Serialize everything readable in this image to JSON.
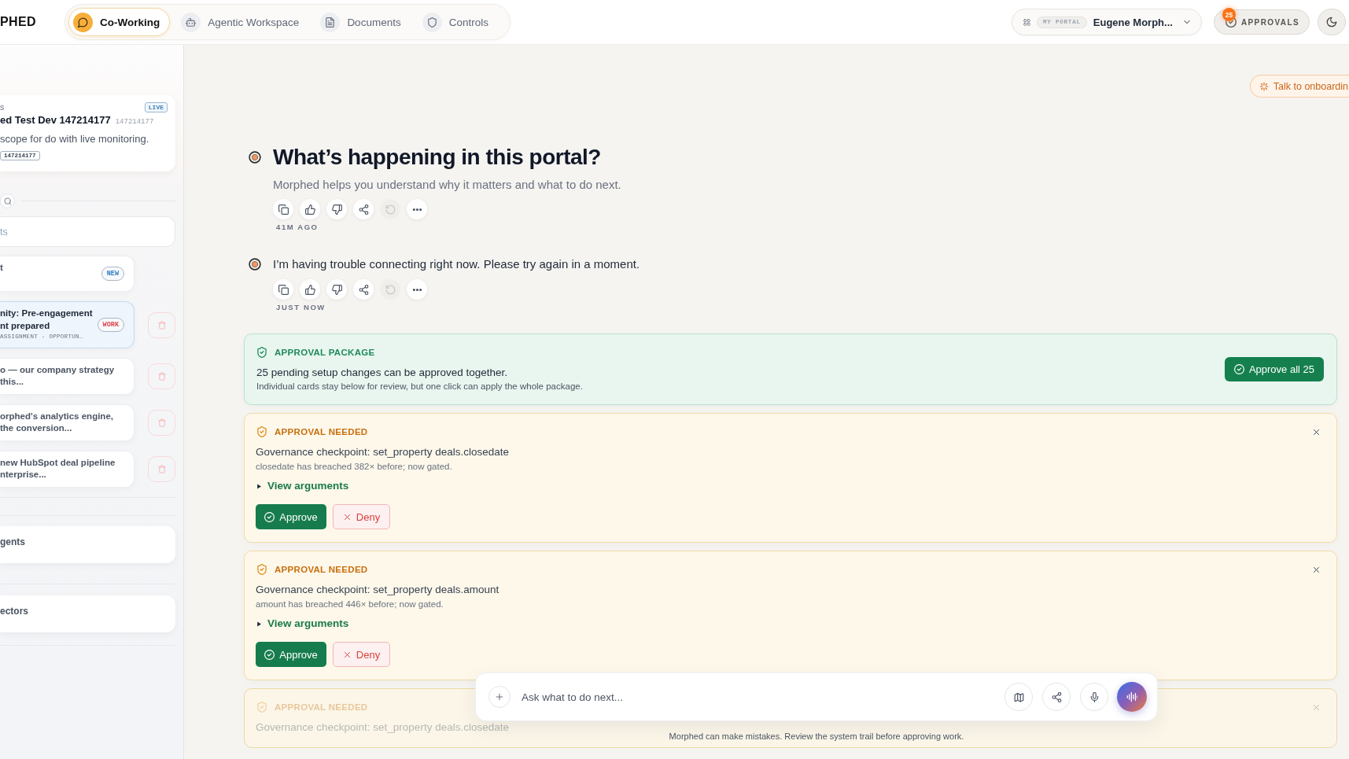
{
  "brand": {
    "text": "PHED"
  },
  "nav": {
    "tabs": [
      {
        "label": "Co-Working",
        "selected": true
      },
      {
        "label": "Agentic Workspace",
        "selected": false
      },
      {
        "label": "Documents",
        "selected": false
      },
      {
        "label": "Controls",
        "selected": false
      }
    ]
  },
  "portal_selector": {
    "badge": "MY PORTAL",
    "name": "Eugene Morph..."
  },
  "approvals_button": {
    "label": "APPROVALS",
    "count": "25"
  },
  "sidebar": {
    "context_card": {
      "label": "s",
      "title": "ed Test Dev 147214177",
      "id": "147214177",
      "description": "scope for do with live monitoring.",
      "tag": "147214177",
      "status": "LIVE"
    },
    "search": {
      "placeholder": "ts"
    },
    "threads": [
      {
        "lines": [
          "t"
        ],
        "badge": {
          "text": "NEW",
          "color": "#2f7fc1"
        },
        "selected": false,
        "delete_button": false
      },
      {
        "lines": [
          "nity: Pre-engagement",
          "nt prepared"
        ],
        "meta": "ASSIGNMENT - OPPORTUN…",
        "badge": {
          "text": "WORK",
          "color": "#e0464f"
        },
        "selected": true,
        "delete_button": true
      },
      {
        "lines": [
          "o — our company strategy",
          "this..."
        ],
        "selected": false,
        "delete_button": true
      },
      {
        "lines": [
          "orphed's analytics engine,",
          "the conversion..."
        ],
        "selected": false,
        "delete_button": true
      },
      {
        "lines": [
          "new HubSpot deal pipeline",
          "nterprise..."
        ],
        "selected": false,
        "delete_button": true
      }
    ],
    "sections": [
      {
        "title": "gents"
      },
      {
        "title": "ectors"
      }
    ]
  },
  "onboarding_button": {
    "label": "Talk to onboardin"
  },
  "conversation": {
    "messages": [
      {
        "kind": "heading",
        "text": "What’s happening in this portal?",
        "subtitle": "Morphed helps you understand why it matters and what to do next.",
        "time": "41M AGO",
        "retry_disabled": true
      },
      {
        "kind": "plain",
        "text": "I’m having trouble connecting right now. Please try again in a moment.",
        "time": "JUST NOW",
        "retry_disabled": true
      }
    ]
  },
  "approval_package": {
    "title": "APPROVAL PACKAGE",
    "summary": "25 pending setup changes can be approved together.",
    "note": "Individual cards stay below for review, but one click can apply the whole package.",
    "button": "Approve all 25"
  },
  "approvals": [
    {
      "title": "APPROVAL NEEDED",
      "checkpoint": "Governance checkpoint: set_property deals.closedate",
      "detail": "closedate has breached 382× before; now gated.",
      "toggle": "View arguments",
      "expanded": false,
      "approve": "Approve",
      "deny": "Deny",
      "faded": false
    },
    {
      "title": "APPROVAL NEEDED",
      "checkpoint": "Governance checkpoint: set_property deals.amount",
      "detail": "amount has breached 446× before; now gated.",
      "toggle": "View arguments",
      "expanded": false,
      "approve": "Approve",
      "deny": "Deny",
      "faded": false
    },
    {
      "title": "APPROVAL NEEDED",
      "checkpoint": "Governance checkpoint: set_property deals.closedate",
      "faded": true
    }
  ],
  "composer": {
    "placeholder": "Ask what to do next..."
  },
  "disclaimer": "Morphed can make mistakes. Review the system trail before approving work."
}
